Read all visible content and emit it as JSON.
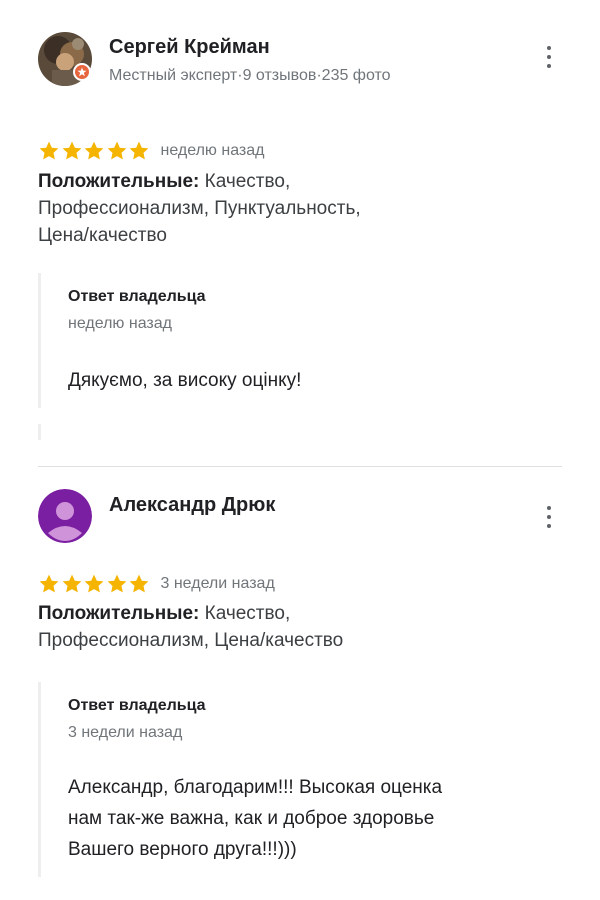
{
  "reviews": [
    {
      "author": "Сергей Крейман",
      "meta": "Местный эксперт·9 отзывов·235 фото",
      "rating": 5,
      "date": "неделю назад",
      "positives_label": "Положительные:",
      "positives_lines": [
        "Качество,",
        "Профессионализм, Пунктуальность,",
        "Цена/качество"
      ],
      "reply": {
        "title": "Ответ владельца",
        "date": "неделю назад",
        "text": "Дякуємо, за високу оцінку!"
      }
    },
    {
      "author": "Александр Дрюк",
      "rating": 5,
      "date": "3 недели назад",
      "positives_label": "Положительные:",
      "positives_lines": [
        "Качество,",
        "Профессионализм, Цена/качество"
      ],
      "reply": {
        "title": "Ответ владельца",
        "date": "3 недели назад",
        "text_lines": [
          "Александр, благодарим!!! Высокая оценка",
          "нам так-же важна, как и доброе здоровье",
          "Вашего верного друга!!!)))"
        ]
      }
    }
  ],
  "colors": {
    "star": "#f4b400",
    "avatar_purple": "#7b1fa2",
    "local_guide_badge": "#e8663d",
    "muted_text": "#70757a"
  },
  "icons": {
    "star": "star-icon",
    "more": "more-vert-icon",
    "badge": "local-guide-badge-icon",
    "default_avatar": "person-icon"
  }
}
